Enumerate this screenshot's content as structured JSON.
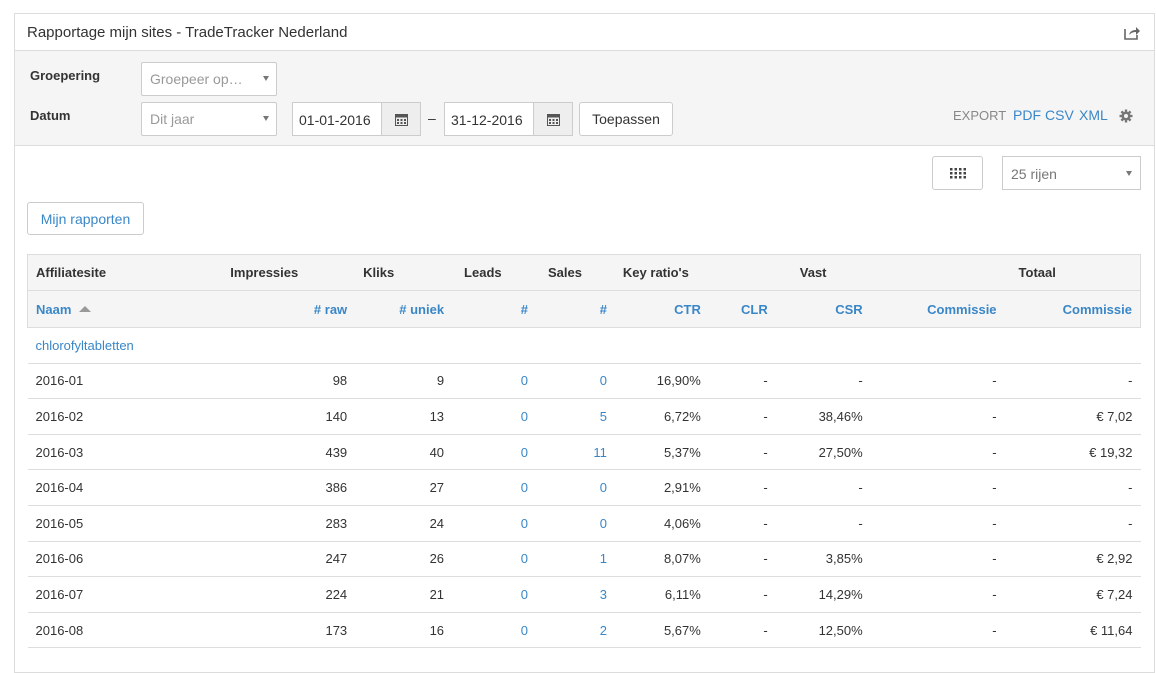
{
  "panel": {
    "title": "Rapportage mijn sites - TradeTracker Nederland"
  },
  "filters": {
    "grouping_label": "Groepering",
    "grouping_placeholder": "Groepeer op…",
    "date_label": "Datum",
    "date_preset": "Dit jaar",
    "date_from": "01-01-2016",
    "date_to": "31-12-2016",
    "dash": "–",
    "apply_label": "Toepassen"
  },
  "export": {
    "label": "EXPORT",
    "pdf": "PDF",
    "csv": "CSV",
    "xml": "XML"
  },
  "toolbar": {
    "rows_select": "25 rijen",
    "my_reports": "Mijn rapporten"
  },
  "table": {
    "group_headers": [
      "Affiliatesite",
      "Impressies",
      "Kliks",
      "Leads",
      "Sales",
      "Key ratio's",
      "Vast",
      "Totaal"
    ],
    "columns": [
      "Naam",
      "# raw",
      "# uniek",
      "#",
      "#",
      "CTR",
      "CLR",
      "CSR",
      "Commissie",
      "Commissie"
    ],
    "site": "chlorofyltabletten",
    "rows": [
      [
        "2016-01",
        "98",
        "9",
        "0",
        "0",
        "16,90%",
        "-",
        "-",
        "-",
        "-"
      ],
      [
        "2016-02",
        "140",
        "13",
        "0",
        "5",
        "6,72%",
        "-",
        "38,46%",
        "-",
        "€ 7,02"
      ],
      [
        "2016-03",
        "439",
        "40",
        "0",
        "11",
        "5,37%",
        "-",
        "27,50%",
        "-",
        "€ 19,32"
      ],
      [
        "2016-04",
        "386",
        "27",
        "0",
        "0",
        "2,91%",
        "-",
        "-",
        "-",
        "-"
      ],
      [
        "2016-05",
        "283",
        "24",
        "0",
        "0",
        "4,06%",
        "-",
        "-",
        "-",
        "-"
      ],
      [
        "2016-06",
        "247",
        "26",
        "0",
        "1",
        "8,07%",
        "-",
        "3,85%",
        "-",
        "€ 2,92"
      ],
      [
        "2016-07",
        "224",
        "21",
        "0",
        "3",
        "6,11%",
        "-",
        "14,29%",
        "-",
        "€ 7,24"
      ],
      [
        "2016-08",
        "173",
        "16",
        "0",
        "2",
        "5,67%",
        "-",
        "12,50%",
        "-",
        "€ 11,64"
      ]
    ]
  },
  "colors": {
    "link": "#3a87c8",
    "header_bg": "#f5f5f5",
    "border": "#dddddd"
  }
}
